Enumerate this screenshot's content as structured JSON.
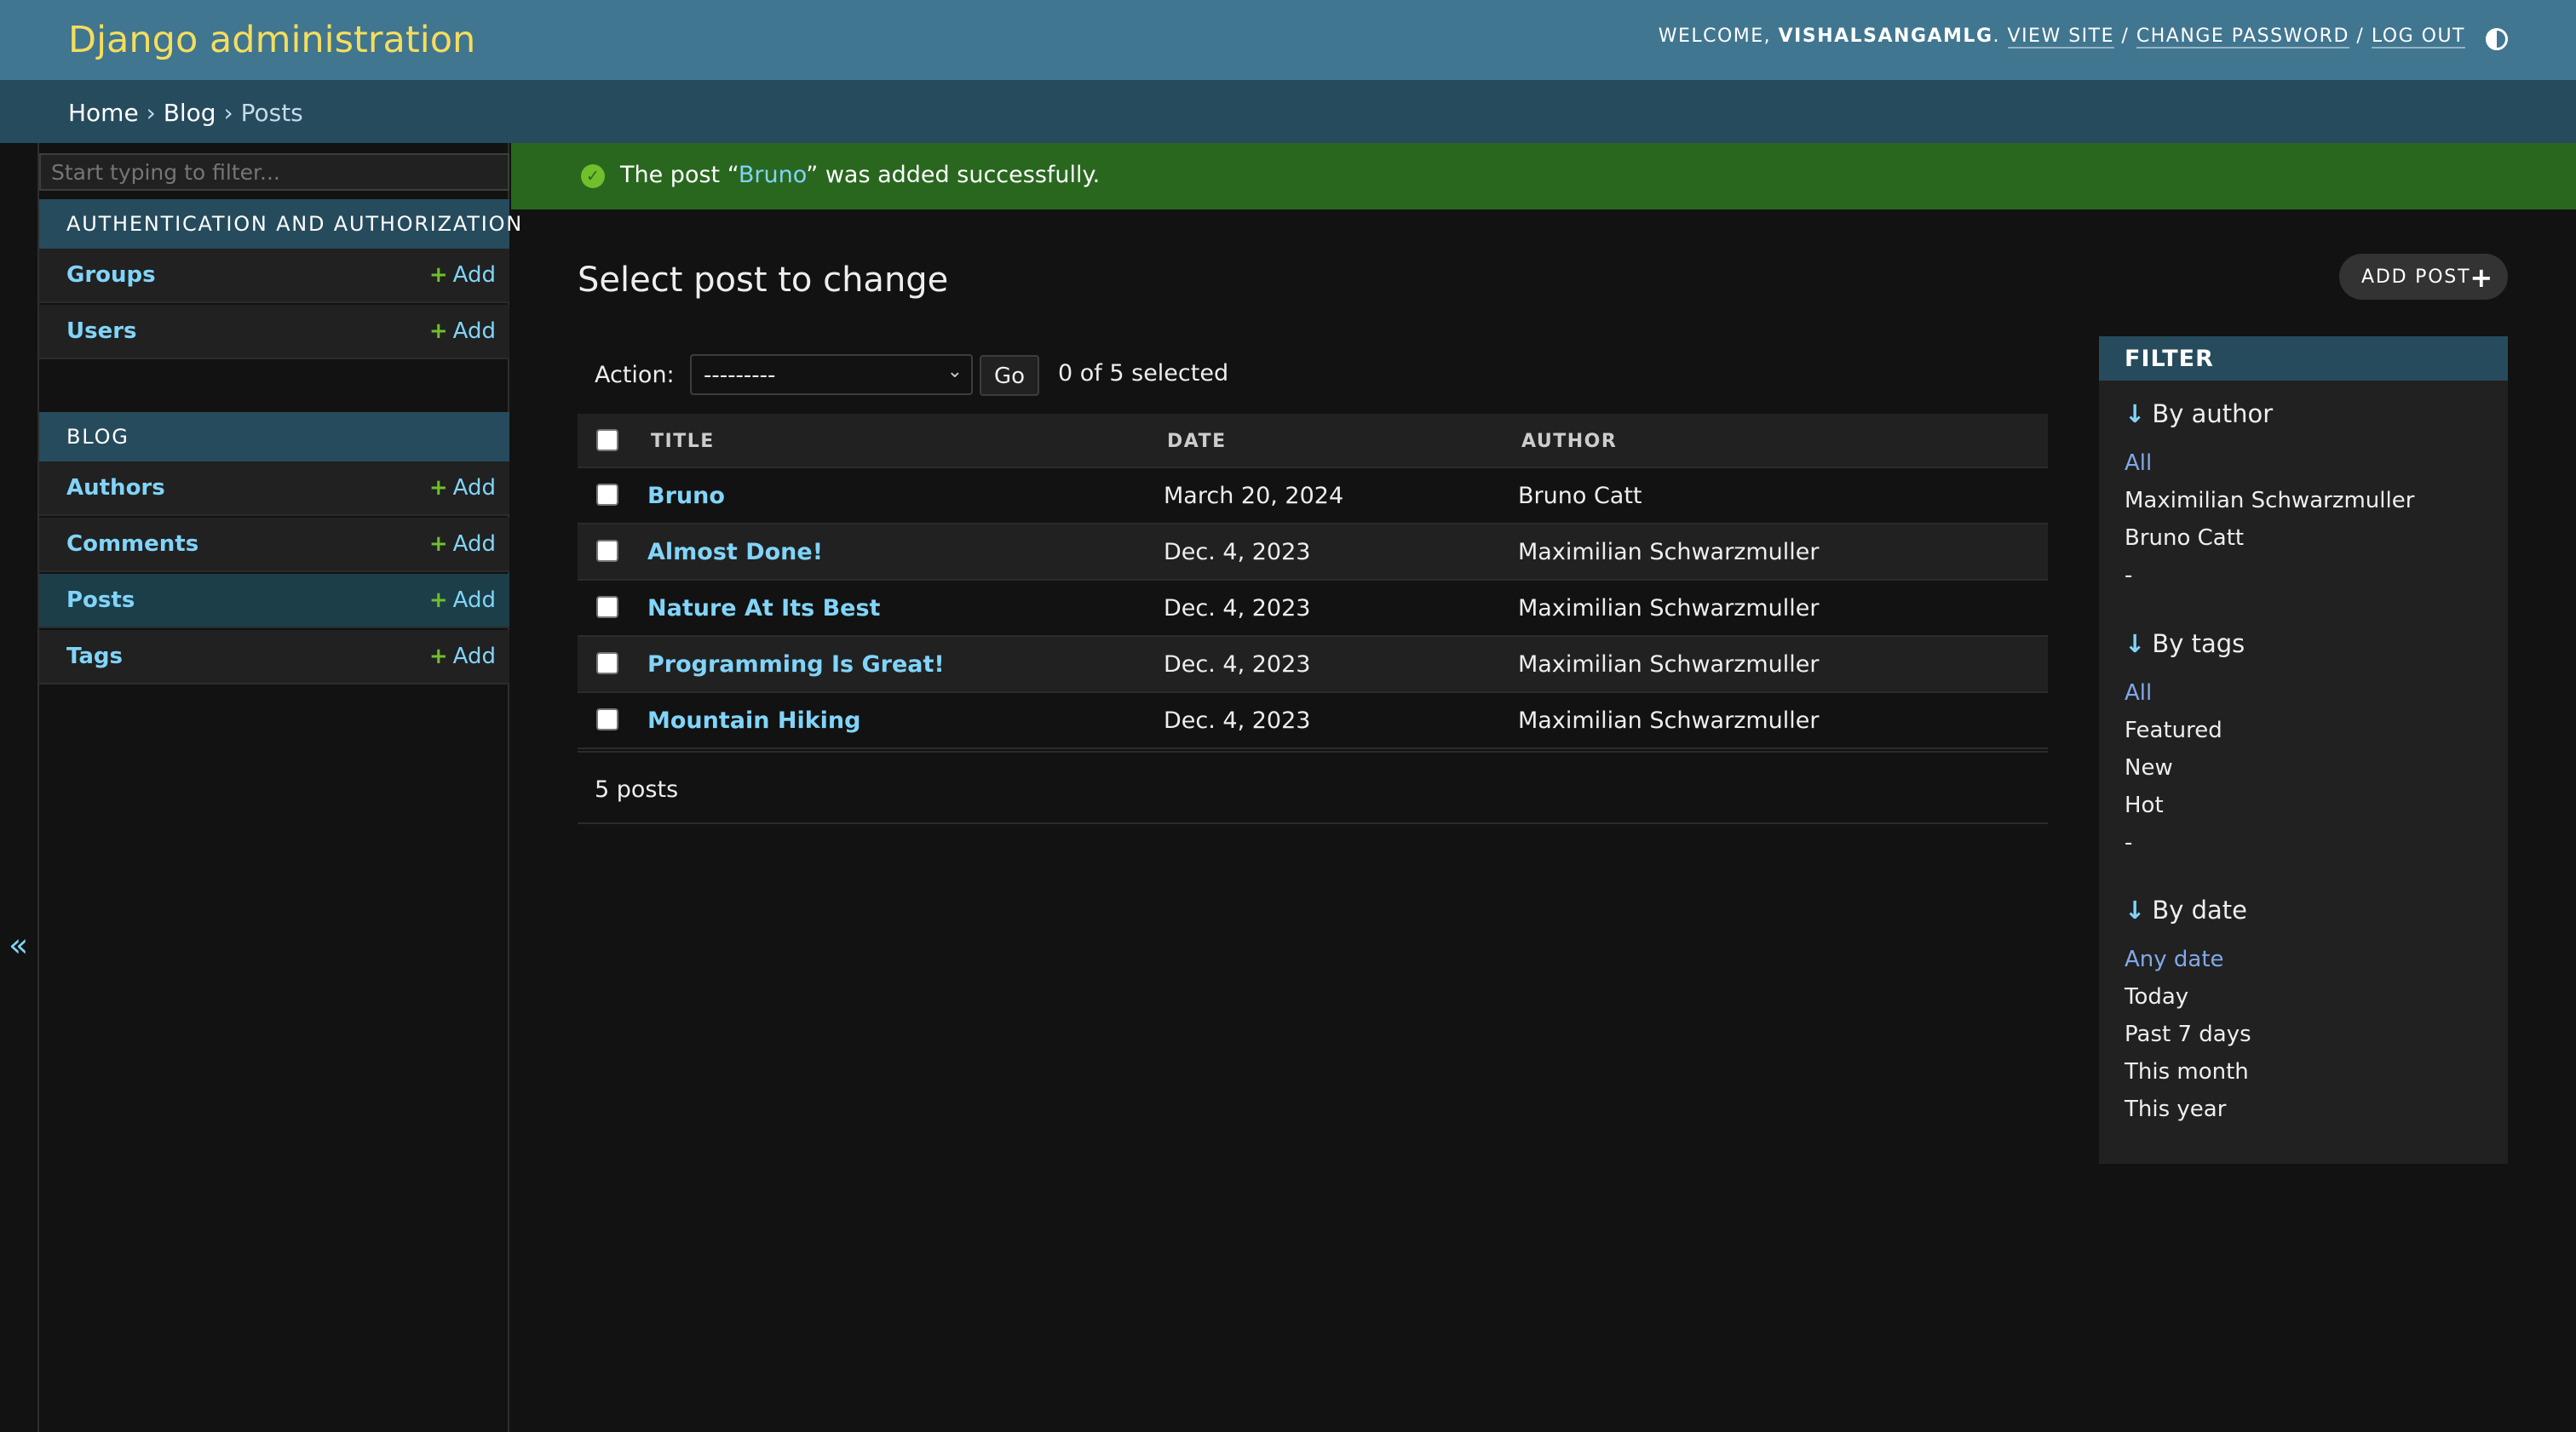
{
  "header": {
    "site_name": "Django administration",
    "welcome": "WELCOME, ",
    "username": "VISHALSANGAMLG",
    "view_site": "VIEW SITE",
    "change_password": "CHANGE PASSWORD",
    "log_out": "LOG OUT",
    "separator": " / "
  },
  "breadcrumbs": {
    "home": "Home",
    "app": "Blog",
    "current": "Posts",
    "sep": " › "
  },
  "toggle_nav": {
    "icon": "«"
  },
  "sidebar": {
    "filter_placeholder": "Start typing to filter...",
    "apps": [
      {
        "caption": "AUTHENTICATION AND AUTHORIZATION",
        "models": [
          {
            "name": "Groups",
            "add": "Add"
          },
          {
            "name": "Users",
            "add": "Add"
          }
        ]
      },
      {
        "caption": "BLOG",
        "models": [
          {
            "name": "Authors",
            "add": "Add"
          },
          {
            "name": "Comments",
            "add": "Add"
          },
          {
            "name": "Posts",
            "add": "Add"
          },
          {
            "name": "Tags",
            "add": "Add"
          }
        ]
      }
    ]
  },
  "message": {
    "icon": "✓",
    "prefix": "The post “",
    "link": "Bruno",
    "suffix": "” was added successfully."
  },
  "content": {
    "title": "Select post to change",
    "add_button": "ADD POST",
    "add_icon": "+",
    "action_label": "Action:",
    "action_value": "---------",
    "action_chevron": "⌄",
    "go": "Go",
    "selected": "0 of 5 selected",
    "columns": [
      "TITLE",
      "DATE",
      "AUTHOR"
    ],
    "rows": [
      {
        "title": "Bruno",
        "date": "March 20, 2024",
        "author": "Bruno Catt"
      },
      {
        "title": "Almost Done!",
        "date": "Dec. 4, 2023",
        "author": "Maximilian Schwarzmuller"
      },
      {
        "title": "Nature At Its Best",
        "date": "Dec. 4, 2023",
        "author": "Maximilian Schwarzmuller"
      },
      {
        "title": "Programming Is Great!",
        "date": "Dec. 4, 2023",
        "author": "Maximilian Schwarzmuller"
      },
      {
        "title": "Mountain Hiking",
        "date": "Dec. 4, 2023",
        "author": "Maximilian Schwarzmuller"
      }
    ],
    "paginator": "5 posts"
  },
  "filter": {
    "heading": "FILTER",
    "arrow_icon": "↓",
    "groups": [
      {
        "title": "By author",
        "choices": [
          "All",
          "Maximilian Schwarzmuller",
          "Bruno Catt",
          "-"
        ]
      },
      {
        "title": "By tags",
        "choices": [
          "All",
          "Featured",
          "New",
          "Hot",
          "-"
        ]
      },
      {
        "title": "By date",
        "choices": [
          "Any date",
          "Today",
          "Past 7 days",
          "This month",
          "This year"
        ]
      }
    ]
  },
  "colors": {
    "header_bg": "#417690",
    "site_name": "#f5dd5d",
    "breadcrumbs_bg": "#264b5d",
    "success_bg": "#29671f",
    "link": "#81d4fa",
    "add_plus": "#70bf2b"
  }
}
